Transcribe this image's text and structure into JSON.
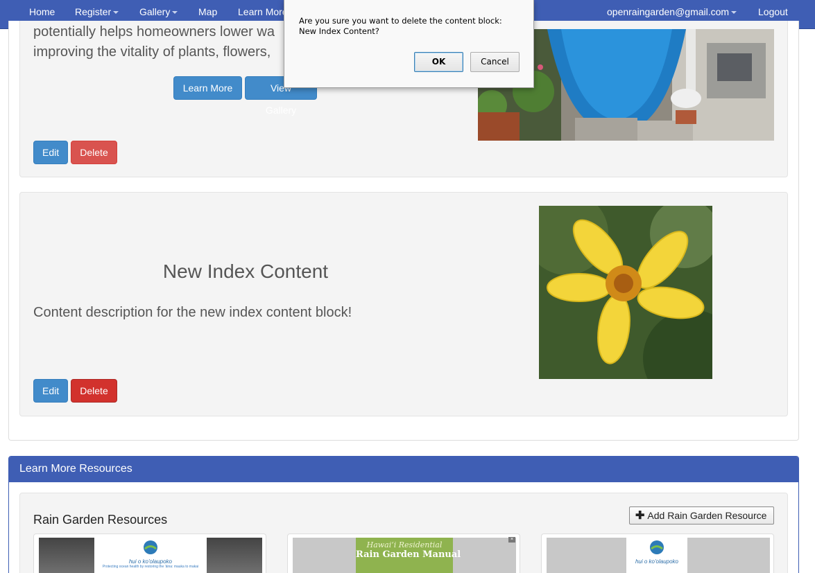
{
  "navbar": {
    "home": "Home",
    "register": "Register",
    "gallery": "Gallery",
    "map": "Map",
    "learn_more": "Learn More",
    "user_email": "openraingarden@gmail.com",
    "logout": "Logout"
  },
  "block1": {
    "text_line1": "potentially helps homeowners lower wa",
    "text_line2": "improving the vitality of plants, flowers,",
    "learn_more_button": "Learn More",
    "view_gallery_button": "View Gallery",
    "edit_button": "Edit",
    "delete_button": "Delete"
  },
  "block2": {
    "title": "New Index Content",
    "description": "Content description for the new index content block!",
    "edit_button": "Edit",
    "delete_button": "Delete"
  },
  "resources": {
    "heading": "Learn More Resources",
    "section_title": "Rain Garden Resources",
    "add_button": "Add Rain Garden Resource",
    "cards": [
      {
        "logo_text": "hui o ko'olaupoko",
        "tagline": "Protecting ocean health by restoring the 'āina: mauka to makai"
      },
      {
        "title_line1": "Hawaiʻi Residential",
        "title_line2": "Rain Garden Manual"
      },
      {
        "logo_text": "hui o ko'olaupoko"
      }
    ]
  },
  "dialog": {
    "message_line1": "Are you sure you want to delete the content block:",
    "message_line2": "New Index Content?",
    "ok_button": "OK",
    "cancel_button": "Cancel"
  },
  "colors": {
    "navbar": "#3f5eb4",
    "primary": "#428bca",
    "danger": "#d9534f"
  }
}
